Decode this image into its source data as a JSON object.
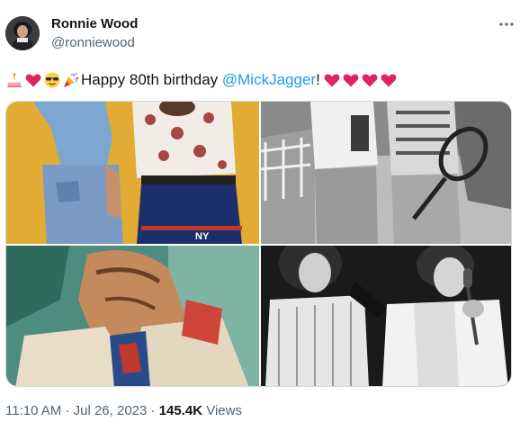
{
  "author": {
    "display_name": "Ronnie Wood",
    "handle": "@ronniewood"
  },
  "tweet": {
    "emojis": [
      "birthday-cake",
      "red-heart",
      "smiling-face-with-sunglasses",
      "party-popper"
    ],
    "text_before_mention": "Happy 80th birthday ",
    "mention": "@MickJagger",
    "text_after_mention": "!",
    "trailing_emojis": [
      "red-heart",
      "red-heart",
      "red-heart",
      "red-heart"
    ]
  },
  "media": {
    "photos": [
      {
        "id": "photo-1",
        "description_icon": "photo-two-people-denim-icon"
      },
      {
        "id": "photo-2",
        "description_icon": "photo-black-white-tennis-icon"
      },
      {
        "id": "photo-3",
        "description_icon": "photo-painting-icon"
      },
      {
        "id": "photo-4",
        "description_icon": "photo-concert-microphone-icon"
      }
    ]
  },
  "meta": {
    "time": "11:10 AM",
    "separator": "·",
    "date": "Jul 26, 2023",
    "views_count": "145.4K",
    "views_label": "Views"
  },
  "colors": {
    "link": "#1d9bf0",
    "secondary_text": "#536471",
    "primary_text": "#0f1419",
    "heart": "#e0245e"
  }
}
